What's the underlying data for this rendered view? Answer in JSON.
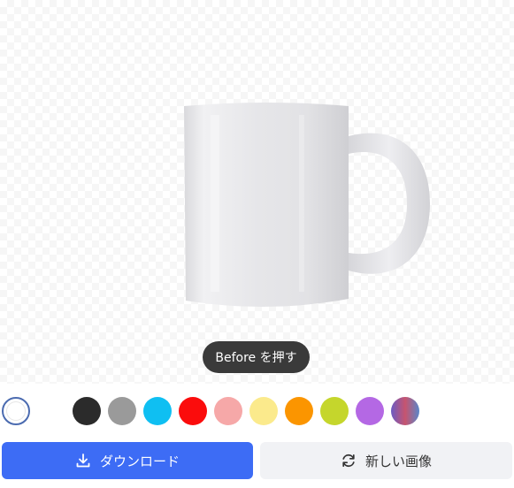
{
  "preview": {
    "before_button_label": "Before を押す"
  },
  "color_swatches": [
    {
      "name": "white",
      "color": "#ffffff",
      "selected": true
    },
    {
      "name": "black",
      "color": "#2b2b2b"
    },
    {
      "name": "gray",
      "color": "#9a9a9a"
    },
    {
      "name": "sky-blue",
      "color": "#0fbff2"
    },
    {
      "name": "red",
      "color": "#fb0c0c"
    },
    {
      "name": "pink",
      "color": "#f6a8a8"
    },
    {
      "name": "light-yellow",
      "color": "#fbea8c"
    },
    {
      "name": "orange",
      "color": "#fb9500"
    },
    {
      "name": "lime",
      "color": "#c5d62c"
    },
    {
      "name": "purple",
      "color": "#b468e4"
    },
    {
      "name": "gradient",
      "color": "linear-gradient(90deg,#6b5bc4,#c7546e,#5a86c9)"
    }
  ],
  "actions": {
    "download_label": "ダウンロード",
    "new_image_label": "新しい画像"
  },
  "icons": {
    "download": "download-icon",
    "refresh": "refresh-icon"
  },
  "colors": {
    "primary": "#3d6cf5",
    "secondary_bg": "#f1f2f5",
    "tooltip_bg": "#3a3a3a"
  }
}
